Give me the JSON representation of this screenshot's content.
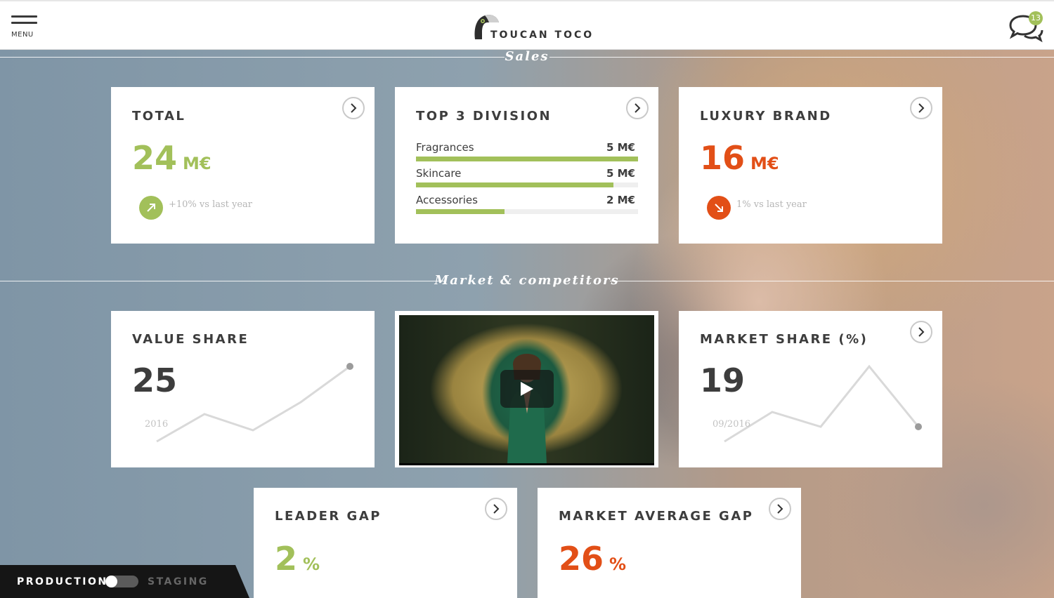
{
  "header": {
    "menu_label": "MENU",
    "brand": "TOUCAN TOCO",
    "notification_count": "13"
  },
  "sections": {
    "sales": "Sales",
    "market": "Market & competitors"
  },
  "total": {
    "title": "TOTAL",
    "value": "24",
    "unit": "M€",
    "trend": "+10% vs last year",
    "trend_direction": "up"
  },
  "top_division": {
    "title": "TOP 3 DIVISION",
    "rows": [
      {
        "name": "Fragrances",
        "value": "5 M€",
        "fraction": 1.0
      },
      {
        "name": "Skincare",
        "value": "5 M€",
        "fraction": 0.89
      },
      {
        "name": "Accessories",
        "value": "2 M€",
        "fraction": 0.4
      }
    ]
  },
  "luxury": {
    "title": "LUXURY BRAND",
    "value": "16",
    "unit": "M€",
    "trend": "1% vs last year",
    "trend_direction": "down"
  },
  "value_share": {
    "title": "VALUE SHARE",
    "value": "25",
    "start_label": "2016"
  },
  "market_share": {
    "title": "MARKET SHARE (%)",
    "value": "19",
    "start_label": "09/2016"
  },
  "leader_gap": {
    "title": "LEADER GAP",
    "value": "2",
    "unit": "%"
  },
  "market_avg_gap": {
    "title": "MARKET AVERAGE GAP",
    "value": "26",
    "unit": "%"
  },
  "env": {
    "production": "PRODUCTION",
    "staging": "STAGING"
  },
  "colors": {
    "accent_green": "#a2c05a",
    "accent_orange": "#e24f17",
    "text": "#3d3d3d"
  }
}
